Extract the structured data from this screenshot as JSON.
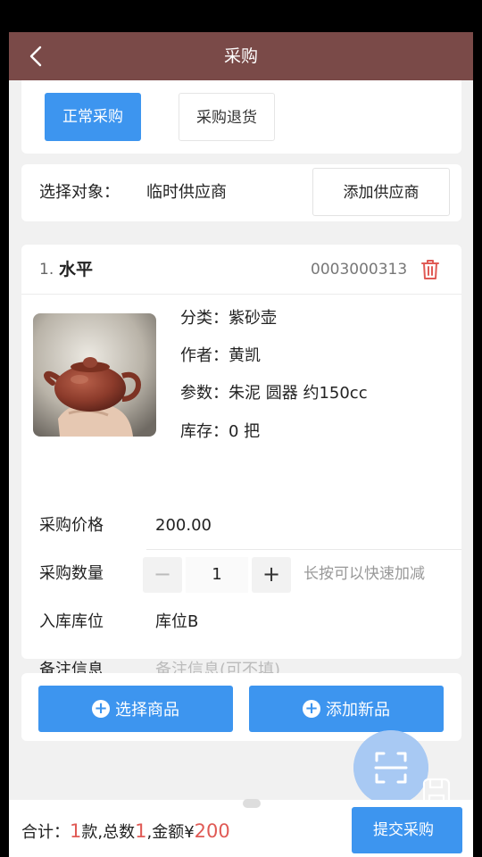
{
  "header": {
    "title": "采购"
  },
  "tabs": {
    "normal": "正常采购",
    "return": "采购退货"
  },
  "target": {
    "label": "选择对象：",
    "value": "临时供应商",
    "add_supplier": "添加供应商"
  },
  "product": {
    "index": "1.",
    "name": "水平",
    "code": "0003000313",
    "attrs": [
      "分类：紫砂壶",
      "作者：黄凯",
      "参数：朱泥  圆器  约150cc",
      "库存：0 把"
    ]
  },
  "form": {
    "price_label": "采购价格",
    "price_value": "200.00",
    "qty_label": "采购数量",
    "qty_minus": "−",
    "qty_value": "1",
    "qty_plus": "+",
    "qty_hint": "长按可以快速加减",
    "location_label": "入库库位",
    "location_value": "库位B",
    "note_label": "备注信息",
    "note_placeholder": "备注信息(可不填)"
  },
  "actions": {
    "select": "选择商品",
    "add_new": "添加新品"
  },
  "footer": {
    "total_prefix": "合计：",
    "count": "1",
    "count_suffix": "款,总数",
    "quantity": "1",
    "amount_prefix": ",金额¥",
    "amount": "200",
    "submit": "提交采购"
  },
  "colors": {
    "header": "#7a4a48",
    "primary": "#3d95ef",
    "price_red": "#e05a55"
  }
}
